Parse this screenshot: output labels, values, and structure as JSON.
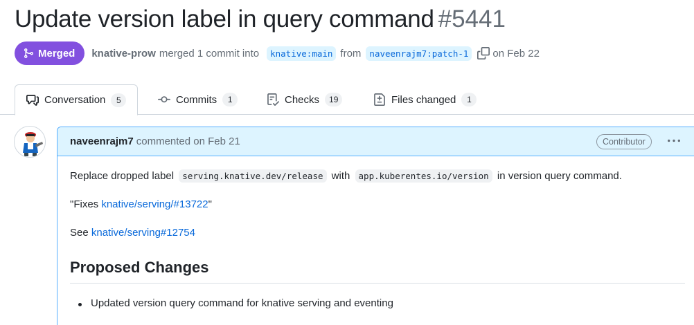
{
  "pr": {
    "title": "Update version label in query command",
    "number": "#5441",
    "status_label": "Merged",
    "author": "knative-prow",
    "merged_text": "merged 1 commit into",
    "base_branch": "knative:main",
    "from_text": "from",
    "head_branch": "naveenrajm7:patch-1",
    "date_text": "on Feb 22"
  },
  "tabs": [
    {
      "label": "Conversation",
      "count": "5",
      "icon": "comment-discussion-icon"
    },
    {
      "label": "Commits",
      "count": "1",
      "icon": "git-commit-icon"
    },
    {
      "label": "Checks",
      "count": "19",
      "icon": "checklist-icon"
    },
    {
      "label": "Files changed",
      "count": "1",
      "icon": "file-diff-icon"
    }
  ],
  "comment": {
    "author": "naveenrajm7",
    "meta": "commented on Feb 21",
    "badge": "Contributor",
    "line1_before": "Replace dropped label",
    "code1": "serving.knative.dev/release",
    "line1_mid": "with",
    "code2": "app.kuberentes.io/version",
    "line1_after": "in version query command.",
    "fixes_prefix": "\"Fixes",
    "fixes_link": "knative/serving/#13722",
    "fixes_suffix": "\"",
    "see_prefix": "See",
    "see_link": "knative/serving#12754",
    "heading": "Proposed Changes",
    "bullets": [
      "Updated version query command for knative serving and eventing"
    ]
  },
  "colors": {
    "merged": "#8250df",
    "link": "#0969da",
    "comment_header_bg": "#ddf4ff",
    "comment_border": "#54aeff"
  }
}
